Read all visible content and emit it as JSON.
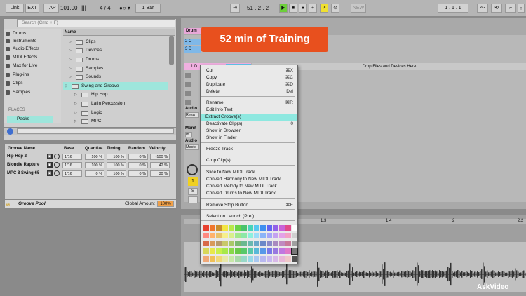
{
  "transport": {
    "link": "Link",
    "ext": "EXT",
    "tap": "TAP",
    "tempo": "101.00",
    "sig": "4 / 4",
    "quantize": "1 Bar",
    "position": "51 .  2 .  2",
    "new": "NEW",
    "loop_pos": "1 .  1 .  1"
  },
  "browser": {
    "search_placeholder": "Search (Cmd + F)",
    "categories": [
      "Drums",
      "Instruments",
      "Audio Effects",
      "MIDI Effects",
      "Max for Live",
      "Plug-ins",
      "Clips",
      "Samples"
    ],
    "places_label": "PLACES",
    "places": [
      "Packs"
    ],
    "name_header": "Name",
    "folders": [
      "Clips",
      "Devices",
      "Drums",
      "Samples",
      "Sounds",
      "Swing and Groove"
    ],
    "subfolders": [
      "Hip Hop",
      "Latin Percussion",
      "Logic",
      "MPC"
    ]
  },
  "groove": {
    "headers": [
      "Groove Name",
      "Base",
      "Quantize",
      "Timing",
      "Random",
      "Velocity"
    ],
    "rows": [
      {
        "name": "Hip Hop 2",
        "base": "1/16",
        "quantize": "100 %",
        "timing": "100 %",
        "random": "0 %",
        "velocity": "-100 %"
      },
      {
        "name": "Blondie Rapture",
        "base": "1/16",
        "quantize": "100 %",
        "timing": "100 %",
        "random": "0 %",
        "velocity": "42 %"
      },
      {
        "name": "MPC 8 Swing-65",
        "base": "1/16",
        "quantize": "0 %",
        "timing": "100 %",
        "random": "0 %",
        "velocity": "30 %"
      }
    ],
    "pool_label": "Groove Pool",
    "global_label": "Global Amount",
    "global_value": "100%"
  },
  "session": {
    "track_name": "Drum",
    "clip_rows": [
      "1 D",
      "2 C",
      "3 D"
    ],
    "selected_clip": "1 D",
    "drop_text": "Drop Files and Devices Here",
    "side_labels": [
      "Audio",
      "Resa",
      "Monit",
      "In",
      "Audio",
      "Maste"
    ],
    "track_number": "1",
    "solo": "S"
  },
  "arrangement": {
    "ruler": [
      "1.3",
      "1.4",
      "2",
      "2.2"
    ]
  },
  "menu": {
    "items": [
      {
        "label": "Cut",
        "shortcut": "⌘X"
      },
      {
        "label": "Copy",
        "shortcut": "⌘C"
      },
      {
        "label": "Duplicate",
        "shortcut": "⌘D"
      },
      {
        "label": "Delete",
        "shortcut": "Del"
      },
      {
        "label": "Rename",
        "shortcut": "⌘R"
      },
      {
        "label": "Edit Info Text",
        "shortcut": ""
      },
      {
        "label": "Extract Groove(s)",
        "shortcut": ""
      },
      {
        "label": "Deactivate Clip(s)",
        "shortcut": "0"
      },
      {
        "label": "Show in Browser",
        "shortcut": ""
      },
      {
        "label": "Show in Finder",
        "shortcut": ""
      },
      {
        "label": "Freeze Track",
        "shortcut": ""
      },
      {
        "label": "Crop Clip(s)",
        "shortcut": ""
      },
      {
        "label": "Slice to New MIDI Track",
        "shortcut": ""
      },
      {
        "label": "Convert Harmony to New MIDI Track",
        "shortcut": ""
      },
      {
        "label": "Convert Melody to New MIDI Track",
        "shortcut": ""
      },
      {
        "label": "Convert Drums to New MIDI Track",
        "shortcut": ""
      },
      {
        "label": "Remove Stop Button",
        "shortcut": "⌘E"
      },
      {
        "label": "Select on Launch (Pref)",
        "shortcut": ""
      }
    ],
    "highlighted": "Extract Groove(s)",
    "colors": [
      "#e8412f",
      "#f0762b",
      "#c98d2b",
      "#f2e441",
      "#b8e84a",
      "#6ad246",
      "#48c26b",
      "#48d4b9",
      "#58c8f0",
      "#3f8ff0",
      "#6264f0",
      "#9262e8",
      "#c862d8",
      "#e04a8a",
      "#ffffff",
      "#ff8a80",
      "#ffb26b",
      "#e8c26b",
      "#f6ef8c",
      "#d8f08c",
      "#a2e88c",
      "#8ce8a8",
      "#8cf0de",
      "#9cdcf8",
      "#8cb4f8",
      "#a6a6f8",
      "#c4a2f0",
      "#e4a2e8",
      "#f2a2c4",
      "#d0d0d0",
      "#d86a4a",
      "#d89a5a",
      "#b89a6a",
      "#c8c86a",
      "#a8c86a",
      "#7ab870",
      "#6ab890",
      "#6ab8b0",
      "#6aa8c8",
      "#6a88c8",
      "#8a8ac8",
      "#a88ac0",
      "#c08ac0",
      "#c87a9a",
      "#a0a0a0",
      "#d8d85a",
      "#e8e84a",
      "#c8f04a",
      "#a8e84a",
      "#88d84a",
      "#68c84a",
      "#58c86a",
      "#58c8a8",
      "#58b8d8",
      "#5898e8",
      "#7878e8",
      "#9878e0",
      "#c078e0",
      "#e078c8",
      "#787878",
      "#f0a878",
      "#f0c058",
      "#f0d878",
      "#e8e8a8",
      "#c8e8a8",
      "#a8d8a8",
      "#98d8c8",
      "#98d8e8",
      "#a8c8f0",
      "#b8b8f0",
      "#c8b8f0",
      "#d8b8e8",
      "#e8b8d8",
      "#f0c8c8",
      "#505050"
    ]
  },
  "banner": {
    "text": "52 min of Training"
  },
  "watermark": {
    "text": "AskVideo"
  }
}
